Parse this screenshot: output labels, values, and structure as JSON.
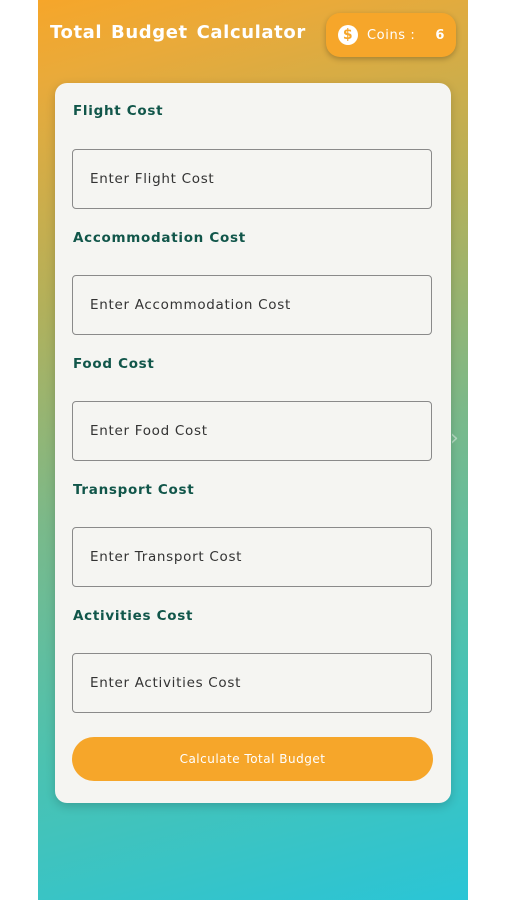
{
  "app": {
    "title": "Total Budget Calculator",
    "coins_label": "Coins :",
    "coins_value": "6",
    "coin_icon": "dollar-coin-icon"
  },
  "form": {
    "fields": [
      {
        "label": "Flight Cost",
        "placeholder": "Enter Flight Cost",
        "value": ""
      },
      {
        "label": "Accommodation Cost",
        "placeholder": "Enter Accommodation Cost",
        "value": ""
      },
      {
        "label": "Food Cost",
        "placeholder": "Enter Food Cost",
        "value": ""
      },
      {
        "label": "Transport Cost",
        "placeholder": "Enter Transport Cost",
        "value": ""
      },
      {
        "label": "Activities Cost",
        "placeholder": "Enter Activities Cost",
        "value": ""
      }
    ],
    "submit_label": "Calculate Total Budget"
  },
  "colors": {
    "accent": "#f6a62a",
    "label_text": "#11564a",
    "gradient_top": "#f6a62a",
    "gradient_bottom": "#2ac5d6",
    "card_bg": "#f5f5f2"
  }
}
